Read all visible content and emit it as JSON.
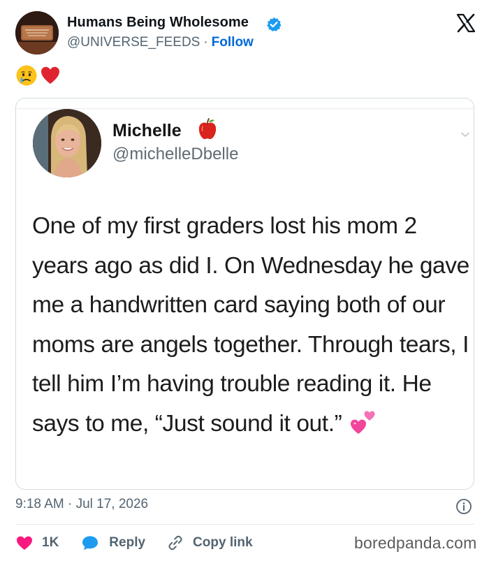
{
  "tweet": {
    "author_name": "Humans Being Wholesome",
    "handle": "@UNIVERSE_FEEDS",
    "separator": "·",
    "follow_label": "Follow",
    "timestamp": "9:18 AM · Jul 17, 2026",
    "emoji_icons": [
      "crying-face-icon",
      "red-heart-icon"
    ]
  },
  "media": {
    "name": "Michelle",
    "handle": "@michelleDbelle",
    "text": "One of my first graders lost his mom 2 years ago as did I. On Wednesday he gave me a handwritten card saying both of our moms are angels together. Through tears, I tell him I’m having trouble reading it. He says to me, “Just sound it out.”"
  },
  "actions": {
    "like_count": "1K",
    "reply_label": "Reply",
    "copy_label": "Copy link"
  },
  "watermark": "boredpanda.com",
  "colors": {
    "verified": "#1d9bf0",
    "follow": "#0069d9",
    "like": "#f91880",
    "reply": "#1d9bf0",
    "muted_text": "#536471"
  }
}
